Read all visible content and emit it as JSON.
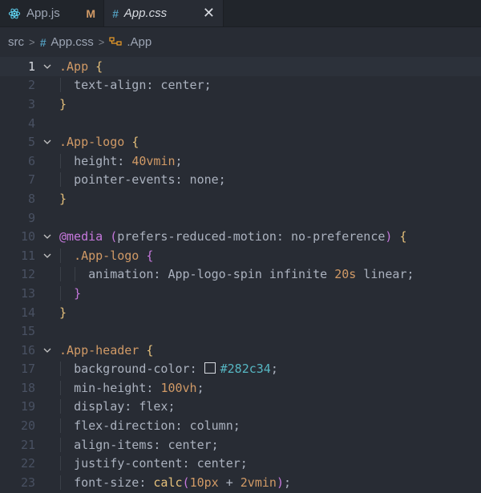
{
  "tabs": [
    {
      "name": "App.js",
      "status": "M"
    },
    {
      "name": "App.css",
      "close": "✕"
    }
  ],
  "breadcrumb": {
    "folder": "src",
    "file": "App.css",
    "symbol": ".App",
    "separator": ">"
  },
  "lines": [
    {
      "n": "1",
      "parts": [
        "App",
        [
          ".App",
          " {"
        ]
      ]
    },
    {
      "n": "2",
      "text": "text-align: center;"
    },
    {
      "n": "3",
      "text": "}"
    },
    {
      "n": "4",
      "text": ""
    },
    {
      "n": "5",
      "text": ".App-logo {"
    },
    {
      "n": "6",
      "text": "height: 40vmin;"
    },
    {
      "n": "7",
      "text": "pointer-events: none;"
    },
    {
      "n": "8",
      "text": "}"
    },
    {
      "n": "9",
      "text": ""
    },
    {
      "n": "10",
      "text": "@media (prefers-reduced-motion: no-preference) {"
    },
    {
      "n": "11",
      "text": ".App-logo {"
    },
    {
      "n": "12",
      "text": "animation: App-logo-spin infinite 20s linear;"
    },
    {
      "n": "13",
      "text": "}"
    },
    {
      "n": "14",
      "text": "}"
    },
    {
      "n": "15",
      "text": ""
    },
    {
      "n": "16",
      "text": ".App-header {"
    },
    {
      "n": "17",
      "text": "background-color: #282c34;"
    },
    {
      "n": "18",
      "text": "min-height: 100vh;"
    },
    {
      "n": "19",
      "text": "display: flex;"
    },
    {
      "n": "20",
      "text": "flex-direction: column;"
    },
    {
      "n": "21",
      "text": "align-items: center;"
    },
    {
      "n": "22",
      "text": "justify-content: center;"
    },
    {
      "n": "23",
      "text": "font-size: calc(10px + 2vmin);"
    }
  ],
  "colors": {
    "background": "#282c34",
    "selector": "#d19a66",
    "bracket_outer": "#e5c07b",
    "bracket_inner": "#c678dd",
    "hex_value": "#56b6c2"
  }
}
